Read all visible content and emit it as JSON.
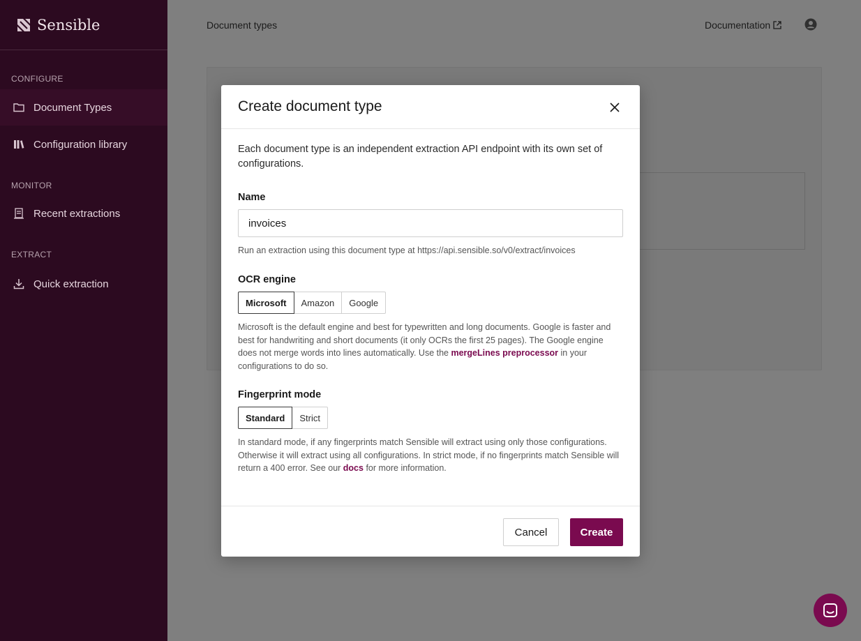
{
  "sidebar": {
    "brand": "Sensible",
    "sections": [
      {
        "label": "CONFIGURE"
      },
      {
        "label": "MONITOR"
      },
      {
        "label": "EXTRACT"
      }
    ],
    "items": [
      {
        "label": "Document Types",
        "icon": "folder-icon",
        "active": true
      },
      {
        "label": "Configuration library",
        "icon": "library-icon",
        "active": false
      },
      {
        "label": "Recent extractions",
        "icon": "document-stack-icon",
        "active": false
      },
      {
        "label": "Quick extraction",
        "icon": "download-icon",
        "active": false
      }
    ]
  },
  "header": {
    "breadcrumb": "Document types",
    "documentation_label": "Documentation"
  },
  "modal": {
    "title": "Create document type",
    "intro": "Each document type is an independent extraction API endpoint with its own set of configurations.",
    "name": {
      "label": "Name",
      "value": "invoices",
      "hint": "Run an extraction using this document type at https://api.sensible.so/v0/extract/invoices"
    },
    "ocr": {
      "label": "OCR engine",
      "options": [
        "Microsoft",
        "Amazon",
        "Google"
      ],
      "selected": "Microsoft",
      "hint_before": "Microsoft is the default engine and best for typewritten and long documents. Google is faster and best for handwriting and short documents (it only OCRs the first 25 pages). The Google engine does not merge words into lines automatically. Use the ",
      "hint_link": "mergeLines preprocessor",
      "hint_after": " in your configurations to do so."
    },
    "fingerprint": {
      "label": "Fingerprint mode",
      "options": [
        "Standard",
        "Strict"
      ],
      "selected": "Standard",
      "hint_before": "In standard mode, if any fingerprints match Sensible will extract using only those configurations. Otherwise it will extract using all configurations. In strict mode, if no fingerprints match Sensible will return a 400 error. See our ",
      "hint_link": "docs",
      "hint_after": " for more information."
    },
    "cancel_label": "Cancel",
    "create_label": "Create"
  },
  "colors": {
    "sidebar_bg": "#2c0a20",
    "accent": "#7a0a4f"
  }
}
